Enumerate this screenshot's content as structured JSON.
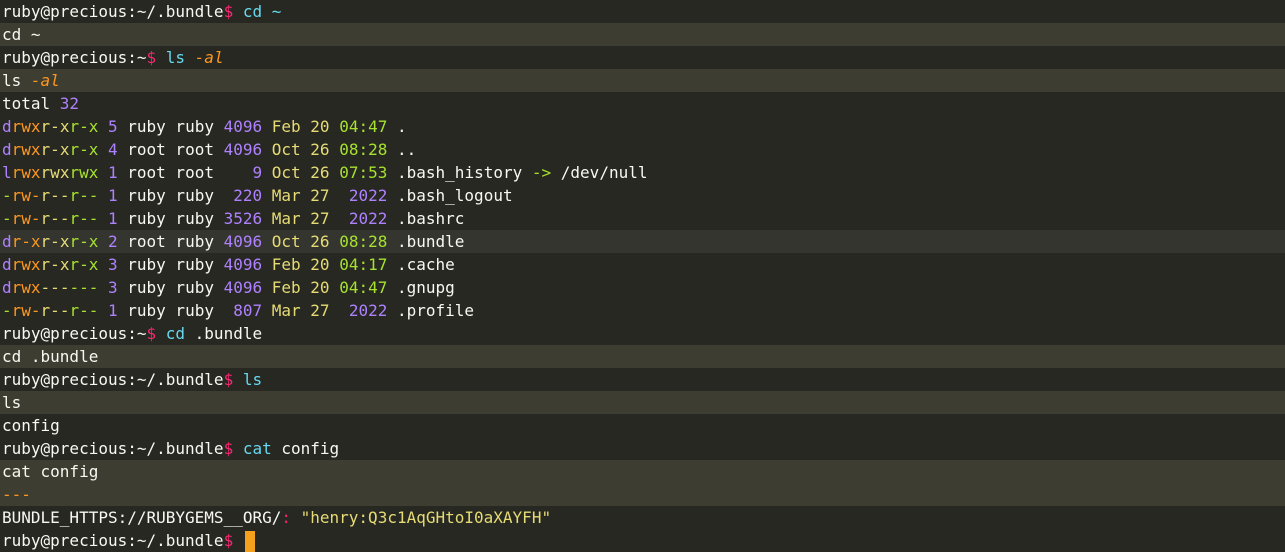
{
  "colors": {
    "background": "#272822",
    "alt_row": "#3e3d32",
    "foreground": "#f8f8f2",
    "prompt_symbol": "#f92672",
    "command": "#66d9ef",
    "flag": "#fd971f",
    "purple": "#ae81ff",
    "green": "#a6e22e",
    "yellow": "#e6db74",
    "cursor": "#f4a11e"
  },
  "terminal": {
    "lines": [
      {
        "bg": "",
        "segs": [
          {
            "t": "ruby@precious:~/.bundle",
            "c": "foreground"
          },
          {
            "t": "$ ",
            "c": "prompt_symbol"
          },
          {
            "t": "cd ~",
            "c": "command"
          }
        ]
      },
      {
        "bg": "alt",
        "segs": [
          {
            "t": "cd ~",
            "c": "foreground"
          }
        ]
      },
      {
        "bg": "",
        "segs": [
          {
            "t": "ruby@precious:~",
            "c": "foreground"
          },
          {
            "t": "$ ",
            "c": "prompt_symbol"
          },
          {
            "t": "ls ",
            "c": "command"
          },
          {
            "t": "-al",
            "c": "flag",
            "i": true
          }
        ]
      },
      {
        "bg": "alt",
        "segs": [
          {
            "t": "ls ",
            "c": "foreground"
          },
          {
            "t": "-al",
            "c": "flag",
            "i": true
          }
        ]
      },
      {
        "bg": "",
        "segs": [
          {
            "t": "total ",
            "c": "foreground"
          },
          {
            "t": "32",
            "c": "purple"
          }
        ]
      },
      {
        "bg": "",
        "segs": [
          {
            "t": "d",
            "c": "purple"
          },
          {
            "t": "rwx",
            "c": "flag"
          },
          {
            "t": "r-x",
            "c": "yellow"
          },
          {
            "t": "r-x",
            "c": "green"
          },
          {
            "t": " 5 ",
            "c": "purple"
          },
          {
            "t": "ruby ruby ",
            "c": "foreground"
          },
          {
            "t": "4096 ",
            "c": "purple"
          },
          {
            "t": "Feb 20 ",
            "c": "yellow"
          },
          {
            "t": "04:47",
            "c": "green"
          },
          {
            "t": " .",
            "c": "foreground"
          }
        ]
      },
      {
        "bg": "",
        "segs": [
          {
            "t": "d",
            "c": "purple"
          },
          {
            "t": "rwx",
            "c": "flag"
          },
          {
            "t": "r-x",
            "c": "yellow"
          },
          {
            "t": "r-x",
            "c": "green"
          },
          {
            "t": " 4 ",
            "c": "purple"
          },
          {
            "t": "root root ",
            "c": "foreground"
          },
          {
            "t": "4096 ",
            "c": "purple"
          },
          {
            "t": "Oct 26 ",
            "c": "yellow"
          },
          {
            "t": "08:28",
            "c": "green"
          },
          {
            "t": " ..",
            "c": "foreground"
          }
        ]
      },
      {
        "bg": "",
        "segs": [
          {
            "t": "l",
            "c": "purple"
          },
          {
            "t": "rwx",
            "c": "flag"
          },
          {
            "t": "rwx",
            "c": "yellow"
          },
          {
            "t": "rwx",
            "c": "green"
          },
          {
            "t": " 1 ",
            "c": "purple"
          },
          {
            "t": "root root    ",
            "c": "foreground"
          },
          {
            "t": "9 ",
            "c": "purple"
          },
          {
            "t": "Oct 26 ",
            "c": "yellow"
          },
          {
            "t": "07:53",
            "c": "green"
          },
          {
            "t": " .bash_history ",
            "c": "foreground"
          },
          {
            "t": "-> ",
            "c": "green"
          },
          {
            "t": "/dev/null",
            "c": "foreground"
          }
        ]
      },
      {
        "bg": "",
        "segs": [
          {
            "t": "-",
            "c": "green"
          },
          {
            "t": "rw-",
            "c": "flag"
          },
          {
            "t": "r--",
            "c": "yellow"
          },
          {
            "t": "r--",
            "c": "green"
          },
          {
            "t": " 1 ",
            "c": "purple"
          },
          {
            "t": "ruby ruby  ",
            "c": "foreground"
          },
          {
            "t": "220 ",
            "c": "purple"
          },
          {
            "t": "Mar 27  ",
            "c": "yellow"
          },
          {
            "t": "2022",
            "c": "purple"
          },
          {
            "t": " .bash_logout",
            "c": "foreground"
          }
        ]
      },
      {
        "bg": "",
        "segs": [
          {
            "t": "-",
            "c": "green"
          },
          {
            "t": "rw-",
            "c": "flag"
          },
          {
            "t": "r--",
            "c": "yellow"
          },
          {
            "t": "r--",
            "c": "green"
          },
          {
            "t": " 1 ",
            "c": "purple"
          },
          {
            "t": "ruby ruby ",
            "c": "foreground"
          },
          {
            "t": "3526 ",
            "c": "purple"
          },
          {
            "t": "Mar 27  ",
            "c": "yellow"
          },
          {
            "t": "2022",
            "c": "purple"
          },
          {
            "t": " .bashrc",
            "c": "foreground"
          }
        ]
      },
      {
        "bg": "hl",
        "segs": [
          {
            "t": "d",
            "c": "purple"
          },
          {
            "t": "r-x",
            "c": "flag"
          },
          {
            "t": "r-x",
            "c": "yellow"
          },
          {
            "t": "r-x",
            "c": "green"
          },
          {
            "t": " 2 ",
            "c": "purple"
          },
          {
            "t": "root ruby ",
            "c": "foreground"
          },
          {
            "t": "4096 ",
            "c": "purple"
          },
          {
            "t": "Oct 26 ",
            "c": "yellow"
          },
          {
            "t": "08:28",
            "c": "green"
          },
          {
            "t": " .bundle",
            "c": "foreground"
          }
        ]
      },
      {
        "bg": "",
        "segs": [
          {
            "t": "d",
            "c": "purple"
          },
          {
            "t": "rwx",
            "c": "flag"
          },
          {
            "t": "r-x",
            "c": "yellow"
          },
          {
            "t": "r-x",
            "c": "green"
          },
          {
            "t": " 3 ",
            "c": "purple"
          },
          {
            "t": "ruby ruby ",
            "c": "foreground"
          },
          {
            "t": "4096 ",
            "c": "purple"
          },
          {
            "t": "Feb 20 ",
            "c": "yellow"
          },
          {
            "t": "04:17",
            "c": "green"
          },
          {
            "t": " .cache",
            "c": "foreground"
          }
        ]
      },
      {
        "bg": "",
        "segs": [
          {
            "t": "d",
            "c": "purple"
          },
          {
            "t": "rwx",
            "c": "flag"
          },
          {
            "t": "---",
            "c": "yellow"
          },
          {
            "t": "---",
            "c": "green"
          },
          {
            "t": " 3 ",
            "c": "purple"
          },
          {
            "t": "ruby ruby ",
            "c": "foreground"
          },
          {
            "t": "4096 ",
            "c": "purple"
          },
          {
            "t": "Feb 20 ",
            "c": "yellow"
          },
          {
            "t": "04:47",
            "c": "green"
          },
          {
            "t": " .gnupg",
            "c": "foreground"
          }
        ]
      },
      {
        "bg": "",
        "segs": [
          {
            "t": "-",
            "c": "green"
          },
          {
            "t": "rw-",
            "c": "flag"
          },
          {
            "t": "r--",
            "c": "yellow"
          },
          {
            "t": "r--",
            "c": "green"
          },
          {
            "t": " 1 ",
            "c": "purple"
          },
          {
            "t": "ruby ruby  ",
            "c": "foreground"
          },
          {
            "t": "807 ",
            "c": "purple"
          },
          {
            "t": "Mar 27  ",
            "c": "yellow"
          },
          {
            "t": "2022",
            "c": "purple"
          },
          {
            "t": " .profile",
            "c": "foreground"
          }
        ]
      },
      {
        "bg": "",
        "segs": [
          {
            "t": "ruby@precious:~",
            "c": "foreground"
          },
          {
            "t": "$ ",
            "c": "prompt_symbol"
          },
          {
            "t": "cd",
            "c": "command"
          },
          {
            "t": " .bundle",
            "c": "foreground"
          }
        ]
      },
      {
        "bg": "alt",
        "segs": [
          {
            "t": "cd .bundle",
            "c": "foreground"
          }
        ]
      },
      {
        "bg": "",
        "segs": [
          {
            "t": "ruby@precious:~/.bundle",
            "c": "foreground"
          },
          {
            "t": "$ ",
            "c": "prompt_symbol"
          },
          {
            "t": "ls",
            "c": "command"
          }
        ]
      },
      {
        "bg": "alt",
        "segs": [
          {
            "t": "ls",
            "c": "foreground"
          }
        ]
      },
      {
        "bg": "",
        "segs": [
          {
            "t": "config",
            "c": "foreground"
          }
        ]
      },
      {
        "bg": "",
        "segs": [
          {
            "t": "ruby@precious:~/.bundle",
            "c": "foreground"
          },
          {
            "t": "$ ",
            "c": "prompt_symbol"
          },
          {
            "t": "cat",
            "c": "command"
          },
          {
            "t": " config",
            "c": "foreground"
          }
        ]
      },
      {
        "bg": "alt",
        "segs": [
          {
            "t": "cat config",
            "c": "foreground"
          }
        ]
      },
      {
        "bg": "alt",
        "segs": [
          {
            "t": "---",
            "c": "flag"
          }
        ]
      },
      {
        "bg": "",
        "segs": [
          {
            "t": "BUNDLE_HTTPS://RUBYGEMS__ORG/",
            "c": "foreground"
          },
          {
            "t": ": ",
            "c": "prompt_symbol"
          },
          {
            "t": "\"henry:Q3c1AqGHtoI0aXAYFH\"",
            "c": "yellow"
          }
        ]
      },
      {
        "bg": "",
        "segs": [
          {
            "t": "ruby@precious:~/.bundle",
            "c": "foreground"
          },
          {
            "t": "$ ",
            "c": "prompt_symbol"
          }
        ],
        "cursor": true
      }
    ]
  }
}
